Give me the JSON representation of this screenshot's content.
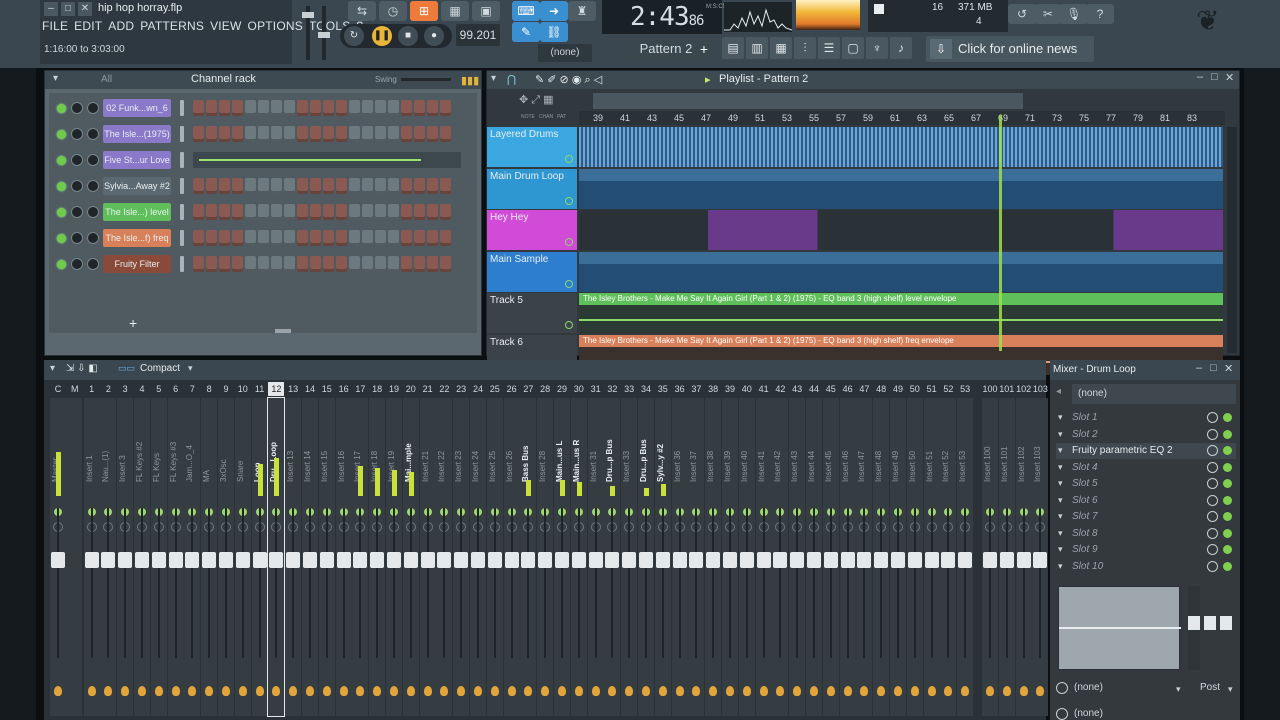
{
  "window": {
    "file_title": "hip hop horray.flp",
    "hint": "1:16:00 to 3:03:00"
  },
  "menu": [
    "FILE",
    "EDIT",
    "ADD",
    "PATTERNS",
    "VIEW",
    "OPTIONS",
    "TOOLS",
    "?"
  ],
  "transport": {
    "time": "2:43",
    "time_small": "86",
    "time_unit": "M:S:CS",
    "tempo": "99.201",
    "pattern": "Pattern 2",
    "snap": "(none)",
    "cpu": "16",
    "ram": "371 MB",
    "poly": "4",
    "news": "Click for online news"
  },
  "channel_rack": {
    "filter": "All",
    "title": "Channel rack",
    "swing_label": "Swing",
    "channels": [
      {
        "name": "02 Funk...wn_6",
        "color": "#8a78c9"
      },
      {
        "name": "The Isle...(1975)",
        "color": "#8a78c9"
      },
      {
        "name": "Five St...ur Love",
        "color": "#8a78c9"
      },
      {
        "name": "Sylvia...Away #2",
        "color": "#5b6a72"
      },
      {
        "name": "The Isle...) level",
        "color": "#5fbf5a"
      },
      {
        "name": "The Isle...f) freq",
        "color": "#d8805a"
      },
      {
        "name": "Fruity Filter",
        "color": "#8a4a3a"
      }
    ]
  },
  "playlist": {
    "title": "Playlist - Pattern 2",
    "ruler": [
      "39",
      "41",
      "43",
      "45",
      "47",
      "49",
      "51",
      "53",
      "55",
      "57",
      "59",
      "61",
      "63",
      "65",
      "67",
      "69",
      "71",
      "73",
      "75",
      "77",
      "79",
      "81",
      "83"
    ],
    "tracks": [
      {
        "name": "Layered Drums",
        "color": "#3aa7e0"
      },
      {
        "name": "Main Drum Loop",
        "color": "#2e96d0"
      },
      {
        "name": "Hey Hey",
        "color": "#d24ad8"
      },
      {
        "name": "Main Sample",
        "color": "#2e7ed0"
      },
      {
        "name": "Track 5",
        "color": "#3b4349"
      },
      {
        "name": "Track 6",
        "color": "#3b4349"
      }
    ],
    "automation_clips": [
      "The Isley Brothers - Make Me Say It Again Girl (Part 1 & 2) (1975) - EQ band 3 (high shelf) level envelope",
      "The Isley Brothers - Make Me Say It Again Girl (Part 1 & 2) (1975) - EQ band 3 (high shelf) freq envelope"
    ],
    "col_labels": [
      "NOTE",
      "CHAN",
      "PAT"
    ]
  },
  "mixer": {
    "view": "Compact",
    "numbers": [
      "C",
      "M",
      "1",
      "2",
      "3",
      "4",
      "5",
      "6",
      "7",
      "8",
      "9",
      "10",
      "11",
      "12",
      "13",
      "14",
      "15",
      "16",
      "17",
      "18",
      "19",
      "20",
      "21",
      "22",
      "23",
      "24",
      "25",
      "26",
      "27",
      "28",
      "29",
      "30",
      "31",
      "32",
      "33",
      "34",
      "35",
      "36",
      "37",
      "38",
      "39",
      "40",
      "41",
      "42",
      "43",
      "44",
      "45",
      "46",
      "47",
      "48",
      "49",
      "50",
      "51",
      "52",
      "53"
    ],
    "numbers_right": [
      "100",
      "101",
      "102",
      "103"
    ],
    "strips": [
      {
        "label": "Master",
        "hi": false,
        "meter": 44
      },
      {
        "label": "Insert 1",
        "hi": false,
        "meter": 0
      },
      {
        "label": "Nau...(1)",
        "hi": false,
        "meter": 0
      },
      {
        "label": "Insert 3",
        "hi": false,
        "meter": 0
      },
      {
        "label": "FL Keys #2",
        "hi": false,
        "meter": 0
      },
      {
        "label": "FL Keys",
        "hi": false,
        "meter": 0
      },
      {
        "label": "FL Keys #3",
        "hi": false,
        "meter": 0
      },
      {
        "label": "Jam...O_4",
        "hi": false,
        "meter": 0
      },
      {
        "label": "MA",
        "hi": false,
        "meter": 0
      },
      {
        "label": "3xOsc",
        "hi": false,
        "meter": 0
      },
      {
        "label": "Snare",
        "hi": false,
        "meter": 0
      },
      {
        "label": "Loop",
        "hi": true,
        "meter": 32
      },
      {
        "label": "Dru...Loop",
        "hi": true,
        "meter": 38
      },
      {
        "label": "Insert 13",
        "hi": false,
        "meter": 0
      },
      {
        "label": "Insert 14",
        "hi": false,
        "meter": 0
      },
      {
        "label": "Insert 15",
        "hi": false,
        "meter": 0
      },
      {
        "label": "Insert 16",
        "hi": false,
        "meter": 0
      },
      {
        "label": "Insert 17",
        "hi": false,
        "meter": 30
      },
      {
        "label": "Insert 18",
        "hi": false,
        "meter": 28
      },
      {
        "label": "Insert 19",
        "hi": false,
        "meter": 26
      },
      {
        "label": "Mai...mple",
        "hi": true,
        "meter": 24
      },
      {
        "label": "Insert 21",
        "hi": false,
        "meter": 0
      },
      {
        "label": "Insert 22",
        "hi": false,
        "meter": 0
      },
      {
        "label": "Insert 23",
        "hi": false,
        "meter": 0
      },
      {
        "label": "Insert 24",
        "hi": false,
        "meter": 0
      },
      {
        "label": "Insert 25",
        "hi": false,
        "meter": 0
      },
      {
        "label": "Insert 26",
        "hi": false,
        "meter": 0
      },
      {
        "label": "Bass Bus",
        "hi": true,
        "meter": 16
      },
      {
        "label": "Insert 28",
        "hi": false,
        "meter": 0
      },
      {
        "label": "Main...us L",
        "hi": true,
        "meter": 16
      },
      {
        "label": "Main...us R",
        "hi": true,
        "meter": 14
      },
      {
        "label": "Insert 31",
        "hi": false,
        "meter": 0
      },
      {
        "label": "Dru...p Bus",
        "hi": true,
        "meter": 10
      },
      {
        "label": "Insert 33",
        "hi": false,
        "meter": 0
      },
      {
        "label": "Dru...p Bus",
        "hi": true,
        "meter": 8
      },
      {
        "label": "Sylv...y #2",
        "hi": true,
        "meter": 12
      },
      {
        "label": "Insert 36",
        "hi": false,
        "meter": 0
      },
      {
        "label": "Insert 37",
        "hi": false,
        "meter": 0
      },
      {
        "label": "Insert 38",
        "hi": false,
        "meter": 0
      },
      {
        "label": "Insert 39",
        "hi": false,
        "meter": 0
      },
      {
        "label": "Insert 40",
        "hi": false,
        "meter": 0
      },
      {
        "label": "Insert 41",
        "hi": false,
        "meter": 0
      },
      {
        "label": "Insert 42",
        "hi": false,
        "meter": 0
      },
      {
        "label": "Insert 43",
        "hi": false,
        "meter": 0
      },
      {
        "label": "Insert 44",
        "hi": false,
        "meter": 0
      },
      {
        "label": "Insert 45",
        "hi": false,
        "meter": 0
      },
      {
        "label": "Insert 46",
        "hi": false,
        "meter": 0
      },
      {
        "label": "Insert 47",
        "hi": false,
        "meter": 0
      },
      {
        "label": "Insert 48",
        "hi": false,
        "meter": 0
      },
      {
        "label": "Insert 49",
        "hi": false,
        "meter": 0
      },
      {
        "label": "Insert 50",
        "hi": false,
        "meter": 0
      },
      {
        "label": "Insert 51",
        "hi": false,
        "meter": 0
      },
      {
        "label": "Insert 52",
        "hi": false,
        "meter": 0
      },
      {
        "label": "Insert 53",
        "hi": false,
        "meter": 0
      }
    ],
    "strips_right": [
      "Insert 100",
      "Insert 101",
      "Insert 102",
      "Insert 103"
    ]
  },
  "inspector": {
    "title": "Mixer - Drum Loop",
    "preset": "(none)",
    "slots": [
      "Slot 1",
      "Slot 2",
      "Fruity parametric EQ 2",
      "Slot 4",
      "Slot 5",
      "Slot 6",
      "Slot 7",
      "Slot 8",
      "Slot 9",
      "Slot 10"
    ],
    "input": "(none)",
    "output": "(none)",
    "post": "Post"
  }
}
